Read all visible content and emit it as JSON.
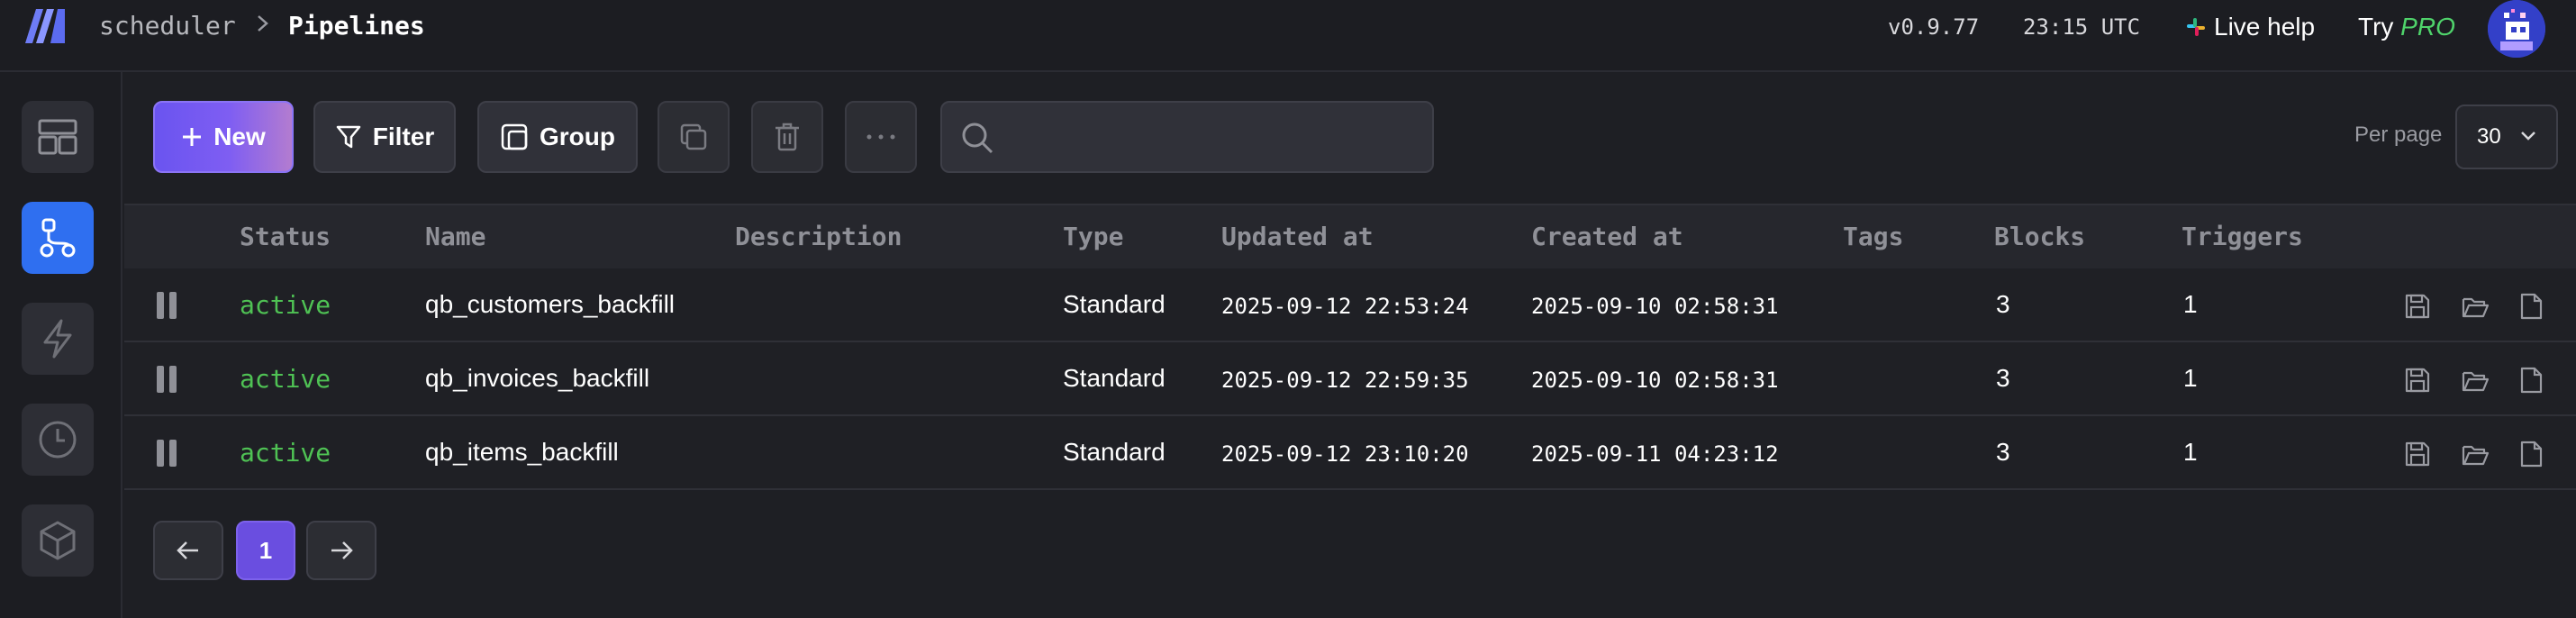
{
  "header": {
    "breadcrumb_app": "scheduler",
    "breadcrumb_page": "Pipelines",
    "version": "v0.9.77",
    "clock": "23:15 UTC",
    "live_help": "Live help",
    "try_label": "Try",
    "try_pro": "PRO"
  },
  "sidebar": {
    "items": [
      {
        "icon": "dashboard-icon",
        "active": false
      },
      {
        "icon": "pipelines-icon",
        "active": true
      },
      {
        "icon": "triggers-icon",
        "active": false
      },
      {
        "icon": "history-icon",
        "active": false
      },
      {
        "icon": "blocks-icon",
        "active": false
      }
    ]
  },
  "toolbar": {
    "new_label": "New",
    "filter_label": "Filter",
    "group_label": "Group",
    "search_placeholder": "",
    "per_page_label": "Per page",
    "per_page_value": "30"
  },
  "table": {
    "columns": {
      "status": "Status",
      "name": "Name",
      "description": "Description",
      "type": "Type",
      "updated_at": "Updated at",
      "created_at": "Created at",
      "tags": "Tags",
      "blocks": "Blocks",
      "triggers": "Triggers"
    },
    "rows": [
      {
        "status": "active",
        "name": "qb_customers_backfill",
        "description": "",
        "type": "Standard",
        "updated_at": "2025-09-12 22:53:24",
        "created_at": "2025-09-10 02:58:31",
        "tags": "",
        "blocks": "3",
        "triggers": "1"
      },
      {
        "status": "active",
        "name": "qb_invoices_backfill",
        "description": "",
        "type": "Standard",
        "updated_at": "2025-09-12 22:59:35",
        "created_at": "2025-09-10 02:58:31",
        "tags": "",
        "blocks": "3",
        "triggers": "1"
      },
      {
        "status": "active",
        "name": "qb_items_backfill",
        "description": "",
        "type": "Standard",
        "updated_at": "2025-09-12 23:10:20",
        "created_at": "2025-09-11 04:23:12",
        "tags": "",
        "blocks": "3",
        "triggers": "1"
      }
    ]
  },
  "pagination": {
    "current_page": "1"
  },
  "colors": {
    "accent": "#2f6ff0",
    "status_active": "#4fc254",
    "pro": "#4fd36b",
    "page_current": "#6a4ee0"
  }
}
